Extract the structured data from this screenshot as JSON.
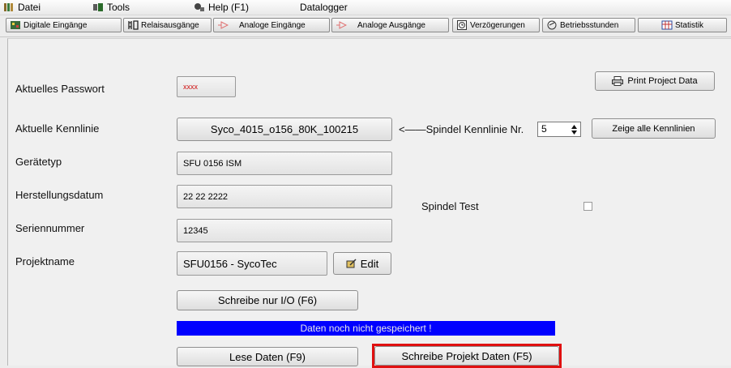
{
  "menu": {
    "datei": "Datei",
    "tools": "Tools",
    "help": "Help (F1)",
    "datalogger": "Datalogger"
  },
  "toolbar": {
    "digitale_eingaenge": "Digitale Eingänge",
    "relaisausgaenge": "Relaisausgänge",
    "analoge_eingaenge": "Analoge Eingänge",
    "analoge_ausgaenge": "Analoge Ausgänge",
    "verzoegerungen": "Verzögerungen",
    "betriebsstunden": "Betriebsstunden",
    "statistik": "Statistik"
  },
  "form": {
    "passwort_label": "Aktuelles Passwort",
    "passwort_value": "xxxx",
    "print_button": "Print Project Data",
    "kennlinie_label": "Aktuelle Kennlinie",
    "kennlinie_value": "Syco_4015_o156_80K_100215",
    "arrow_text": "<——Spindel Kennlinie Nr.",
    "spindel_nr": "5",
    "zeige_button": "Zeige alle Kennlinien",
    "geraetetyp_label": "Gerätetyp",
    "geraetetyp_value": "SFU 0156 ISM",
    "herstellungsdatum_label": "Herstellungsdatum",
    "herstellungsdatum_value": "22 22 2222",
    "spindel_test_label": "Spindel Test",
    "seriennummer_label": "Seriennummer",
    "seriennummer_value": "12345",
    "projektname_label": "Projektname",
    "projektname_value": "SFU0156 - SycoTec",
    "edit_button": "Edit",
    "schreibe_io_button": "Schreibe nur I/O (F6)",
    "status_text": "Daten noch nicht gespeichert !",
    "lese_button": "Lese Daten (F9)",
    "schreibe_projekt_button": "Schreibe Projekt Daten (F5)"
  },
  "colors": {
    "status_bar": "#0000ff",
    "highlight": "#e01010",
    "password_text": "#d01010"
  }
}
